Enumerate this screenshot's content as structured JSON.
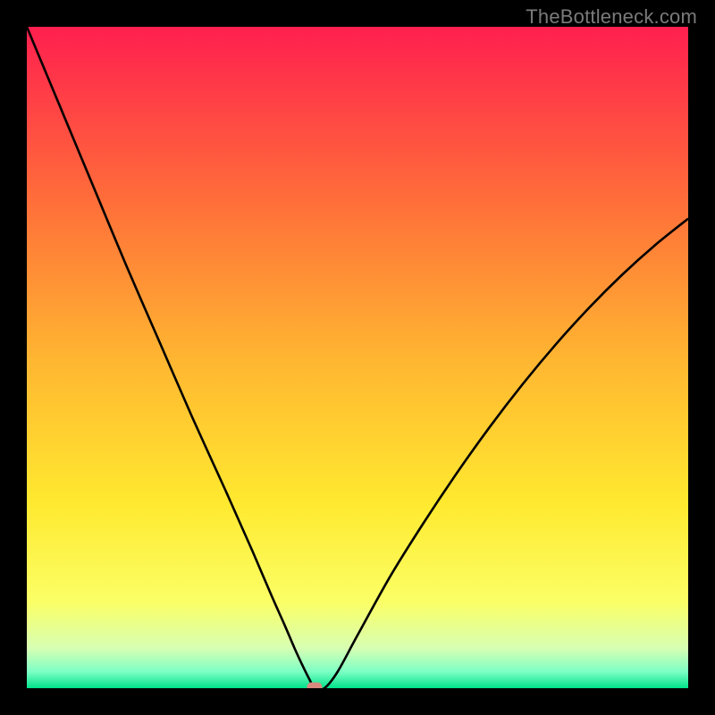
{
  "watermark": "TheBottleneck.com",
  "chart_data": {
    "type": "line",
    "title": "",
    "xlabel": "",
    "ylabel": "",
    "xlim": [
      0,
      100
    ],
    "ylim": [
      0,
      100
    ],
    "grid": false,
    "legend": false,
    "watermark": "TheBottleneck.com",
    "background_gradient": {
      "stops": [
        {
          "pos": 0.0,
          "color": "#ff1f4f"
        },
        {
          "pos": 0.25,
          "color": "#ff6a3a"
        },
        {
          "pos": 0.5,
          "color": "#ffb531"
        },
        {
          "pos": 0.72,
          "color": "#ffe92f"
        },
        {
          "pos": 0.87,
          "color": "#fbff66"
        },
        {
          "pos": 0.94,
          "color": "#d7ffb3"
        },
        {
          "pos": 0.975,
          "color": "#7dffc5"
        },
        {
          "pos": 1.0,
          "color": "#00e28a"
        }
      ]
    },
    "marker": {
      "x": 43.5,
      "y": 0,
      "color": "#d88a7f"
    },
    "series": [
      {
        "name": "curve",
        "color": "#000000",
        "x": [
          0,
          5,
          10,
          15,
          20,
          25,
          30,
          34,
          37,
          39,
          40.5,
          41.8,
          42.8,
          43.5,
          45,
          47,
          50,
          55,
          60,
          65,
          70,
          75,
          80,
          85,
          90,
          95,
          100
        ],
        "y": [
          100,
          88,
          76,
          64,
          52.5,
          41,
          30,
          21,
          14,
          9.5,
          6.0,
          3.2,
          1.2,
          0.0,
          0.0,
          2.5,
          8,
          17,
          25,
          32.5,
          39.5,
          46,
          52,
          57.5,
          62.5,
          67,
          71
        ]
      }
    ]
  }
}
